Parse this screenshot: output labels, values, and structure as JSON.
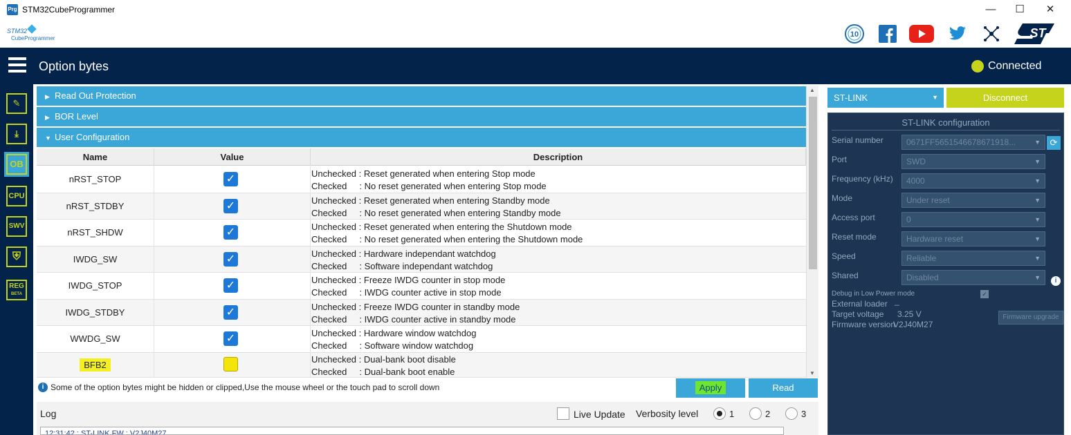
{
  "window": {
    "title": "STM32CubeProgrammer",
    "app_icon_text": "Prg",
    "minimize": "—",
    "maximize": "☐",
    "close": "✕"
  },
  "brand": {
    "logo_top": "STM32",
    "logo_bottom": "CubeProgrammer",
    "icons": [
      "anniversary-10-icon",
      "facebook-icon",
      "youtube-icon",
      "twitter-icon",
      "network-icon",
      "st-logo-icon"
    ],
    "badge_text": "10",
    "st_text": "ST"
  },
  "header": {
    "title": "Option bytes",
    "status": "Connected",
    "status_color": "#c6d31c"
  },
  "sidebar": {
    "items": [
      {
        "name": "edit",
        "label": "✎"
      },
      {
        "name": "download",
        "label": "⤓"
      },
      {
        "name": "ob",
        "label": "OB",
        "active": true
      },
      {
        "name": "cpu",
        "label": "CPU"
      },
      {
        "name": "swv",
        "label": "SWV"
      },
      {
        "name": "security",
        "label": "⛨"
      },
      {
        "name": "reg",
        "label": "REG",
        "sub": "BETA"
      }
    ]
  },
  "sections": {
    "read_out": "Read Out Protection",
    "bor": "BOR Level",
    "user_config": "User Configuration"
  },
  "table": {
    "headers": [
      "Name",
      "Value",
      "Description"
    ],
    "rows": [
      {
        "name": "nRST_STOP",
        "checked": true,
        "unchecked_desc": "Unchecked : Reset generated when entering Stop mode",
        "checked_desc": "Checked     : No reset generated when entering Stop mode"
      },
      {
        "name": "nRST_STDBY",
        "checked": true,
        "unchecked_desc": "Unchecked : Reset generated when entering Standby mode",
        "checked_desc": "Checked     : No reset generated when entering Standby mode"
      },
      {
        "name": "nRST_SHDW",
        "checked": true,
        "unchecked_desc": "Unchecked : Reset generated when entering the Shutdown mode",
        "checked_desc": "Checked     : No reset generated when entering the Shutdown mode"
      },
      {
        "name": "IWDG_SW",
        "checked": true,
        "unchecked_desc": "Unchecked : Hardware independant watchdog",
        "checked_desc": "Checked     : Software independant watchdog"
      },
      {
        "name": "IWDG_STOP",
        "checked": true,
        "unchecked_desc": "Unchecked : Freeze IWDG counter in stop mode",
        "checked_desc": "Checked     : IWDG counter active in stop mode"
      },
      {
        "name": "IWDG_STDBY",
        "checked": true,
        "unchecked_desc": "Unchecked : Freeze IWDG counter in standby mode",
        "checked_desc": "Checked     : IWDG counter active in standby mode"
      },
      {
        "name": "WWDG_SW",
        "checked": true,
        "unchecked_desc": "Unchecked : Hardware window watchdog",
        "checked_desc": "Checked     : Software window watchdog"
      },
      {
        "name": "BFB2",
        "checked": false,
        "unchecked_desc": "Unchecked : Dual-bank boot disable",
        "checked_desc": "Checked     : Dual-bank boot enable"
      }
    ]
  },
  "footer": {
    "info": "Some of the option bytes might be hidden or clipped,Use the mouse wheel or the touch pad to scroll down",
    "apply": "Apply",
    "read": "Read"
  },
  "log": {
    "title": "Log",
    "live_update": "Live Update",
    "verbosity_label": "Verbosity level",
    "levels": [
      "1",
      "2",
      "3"
    ],
    "selected_level": "1",
    "first_line": "12:31:42 : ST-LINK FW   : V2J40M27"
  },
  "right_panel": {
    "interface": "ST-LINK",
    "disconnect": "Disconnect",
    "config_title": "ST-LINK configuration",
    "fields": [
      {
        "label": "Serial number",
        "value": "0671FF5651546678671918..."
      },
      {
        "label": "Port",
        "value": "SWD"
      },
      {
        "label": "Frequency (kHz)",
        "value": "4000"
      },
      {
        "label": "Mode",
        "value": "Under reset"
      },
      {
        "label": "Access port",
        "value": "0"
      },
      {
        "label": "Reset mode",
        "value": "Hardware reset"
      },
      {
        "label": "Speed",
        "value": "Reliable"
      },
      {
        "label": "Shared",
        "value": "Disabled"
      }
    ],
    "debug_low_power": "Debug in Low Power mode",
    "external_loader_label": "External loader",
    "external_loader_value": "_",
    "target_voltage_label": "Target voltage",
    "target_voltage_value": "3.25 V",
    "firmware_version_label": "Firmware version",
    "firmware_version_value": "V2J40M27",
    "firmware_upgrade": "Firmware upgrade"
  }
}
